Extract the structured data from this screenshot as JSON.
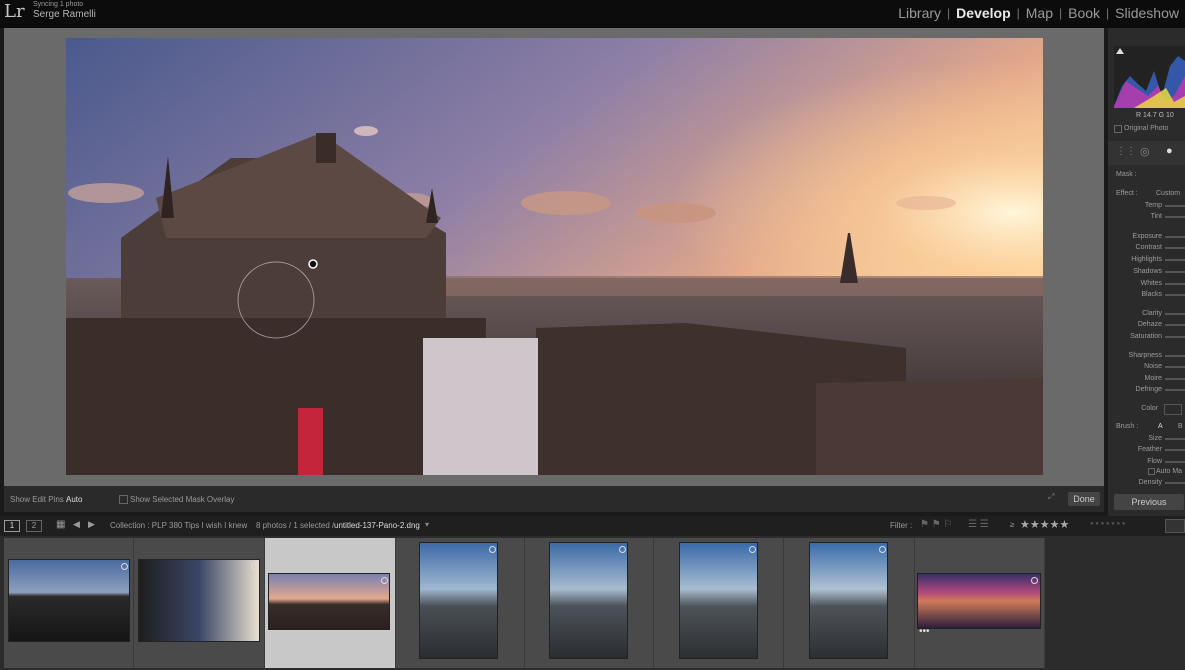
{
  "app": {
    "logo": "Lr",
    "sync_status": "Syncing 1 photo",
    "user_name": "Serge Ramelli"
  },
  "modules": [
    "Library",
    "Develop",
    "Map",
    "Book",
    "Slideshow"
  ],
  "active_module": "Develop",
  "toolbar": {
    "show_edit_pins_label": "Show Edit Pins :",
    "show_edit_pins_value": "Auto",
    "mask_overlay_label": "Show Selected Mask Overlay",
    "done_label": "Done",
    "previous_label": "Previous"
  },
  "histogram": {
    "readout": "R 14.7  G 10",
    "original_photo_label": "Original Photo"
  },
  "mask_panel": {
    "mask_label": "Mask :",
    "effect_label": "Effect :",
    "effect_value": "Custom",
    "temp_label": "Temp",
    "tint_label": "Tint",
    "exposure_label": "Exposure",
    "contrast_label": "Contrast",
    "highlights_label": "Highlights",
    "shadows_label": "Shadows",
    "whites_label": "Whites",
    "blacks_label": "Blacks",
    "clarity_label": "Clarity",
    "dehaze_label": "Dehaze",
    "saturation_label": "Saturation",
    "sharpness_label": "Sharpness",
    "noise_label": "Noise",
    "moire_label": "Moire",
    "defringe_label": "Defringe",
    "color_label": "Color",
    "brush_label": "Brush :",
    "brush_a": "A",
    "brush_b": "B",
    "size_label": "Size",
    "feather_label": "Feather",
    "flow_label": "Flow",
    "auto_mask_label": "Auto Ma",
    "density_label": "Density"
  },
  "filmstrip_bar": {
    "monitor_1": "1",
    "monitor_2": "2",
    "collection_label": "Collection : PLP 380 Tips I wish I knew",
    "count_label": "8 photos / 1 selected /",
    "filename": "untitled-137-Pano-2.dng",
    "filter_label": "Filter :",
    "rating_op": "≥"
  },
  "filmstrip": {
    "selected_index": 2,
    "thumbnails": [
      {
        "kind": "opera-dusk"
      },
      {
        "kind": "opera-sunset"
      },
      {
        "kind": "opera-sunset-selected"
      },
      {
        "kind": "hollywood-vertical"
      },
      {
        "kind": "hollywood-vertical"
      },
      {
        "kind": "hollywood-vertical"
      },
      {
        "kind": "hollywood-vertical"
      },
      {
        "kind": "hollywood-pano"
      }
    ]
  },
  "colors": {
    "accent": "#eaeaea",
    "panel_bg": "#2b2b2b",
    "stage_bg": "#6a6a6a",
    "topbar_bg": "#0c0c0c"
  }
}
